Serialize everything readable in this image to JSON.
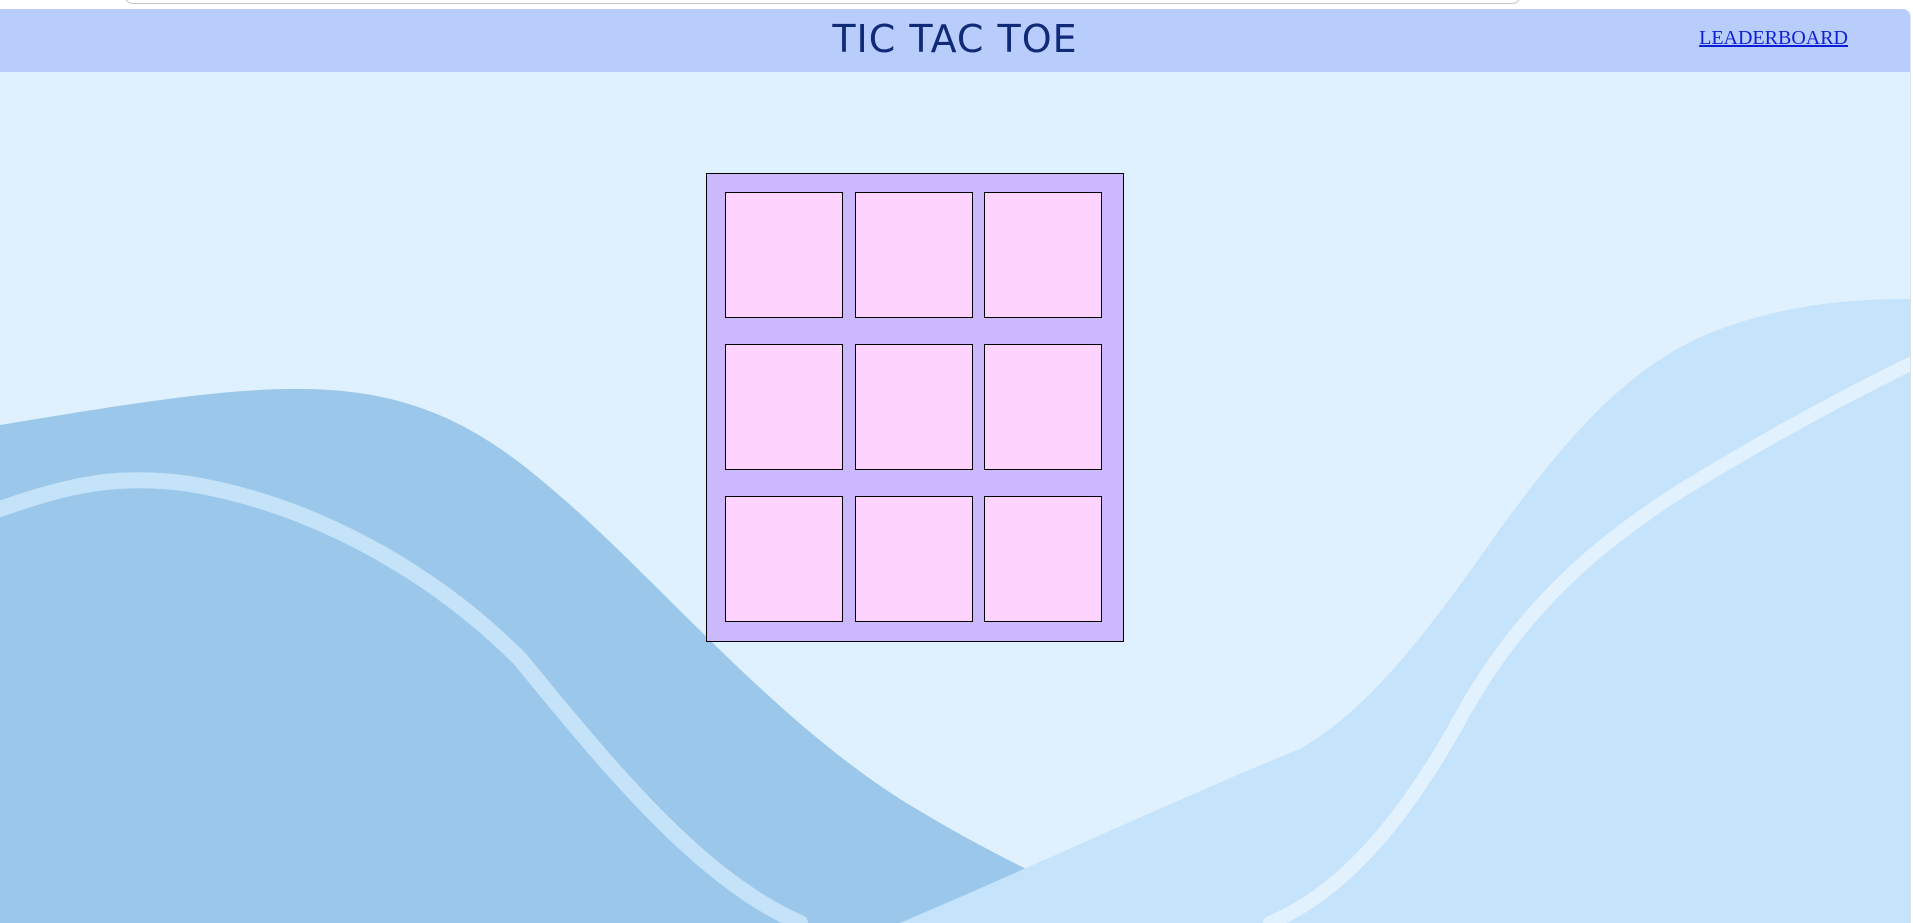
{
  "header": {
    "title": "TIC TAC TOE",
    "leaderboard_label": "LEADERBOARD"
  },
  "board": {
    "cells": [
      "",
      "",
      "",
      "",
      "",
      "",
      "",
      "",
      ""
    ]
  },
  "colors": {
    "header_bg": "#b9cdfd",
    "page_bg": "#dff1fe",
    "board_bg": "#cbb8fd",
    "cell_bg": "#fed4ff",
    "title_color": "#102a78",
    "link_color": "#0b1fd6"
  }
}
